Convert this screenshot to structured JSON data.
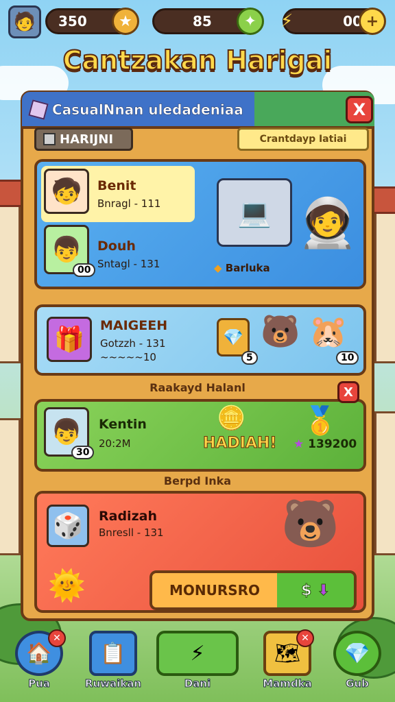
{
  "topbar": {
    "stat1": "350",
    "stat2": "85",
    "stat3": "00",
    "stat3_action": "+"
  },
  "title": "Cantzakan Harigai",
  "panel": {
    "header_title": "CasualNnan uledadeniaa",
    "close": "X",
    "tab_label": "HARIJNI",
    "right_chip": "Crantdayp Iatiai",
    "card1": {
      "player1_name": "Benit",
      "player1_sub": "Bnragl - 111",
      "player2_name": "Douh",
      "player2_sub": "Sntagl - 131",
      "player2_badge": "00",
      "tag": "Barluka"
    },
    "card2": {
      "name": "MAIGEEH",
      "sub1": "Gotzzh - 131",
      "sub2": "~~~~~10",
      "badge1": "5",
      "badge2": "10"
    },
    "section1": "Raakayd Halanl",
    "card3": {
      "name": "Kentin",
      "sub": "20:2M",
      "badge": "30",
      "hadiah": "HADIAH!",
      "reward": "139200",
      "close": "X"
    },
    "section2": "Berpd Inka",
    "card4": {
      "name": "Radizah",
      "sub": "Bnresll - 131",
      "action_left": "MONURSRO",
      "action_right": "$"
    }
  },
  "nav": [
    {
      "label": "Pua"
    },
    {
      "label": "Ruwaikan"
    },
    {
      "label": "Dani"
    },
    {
      "label": "Mamdka"
    },
    {
      "label": "Gub"
    }
  ]
}
